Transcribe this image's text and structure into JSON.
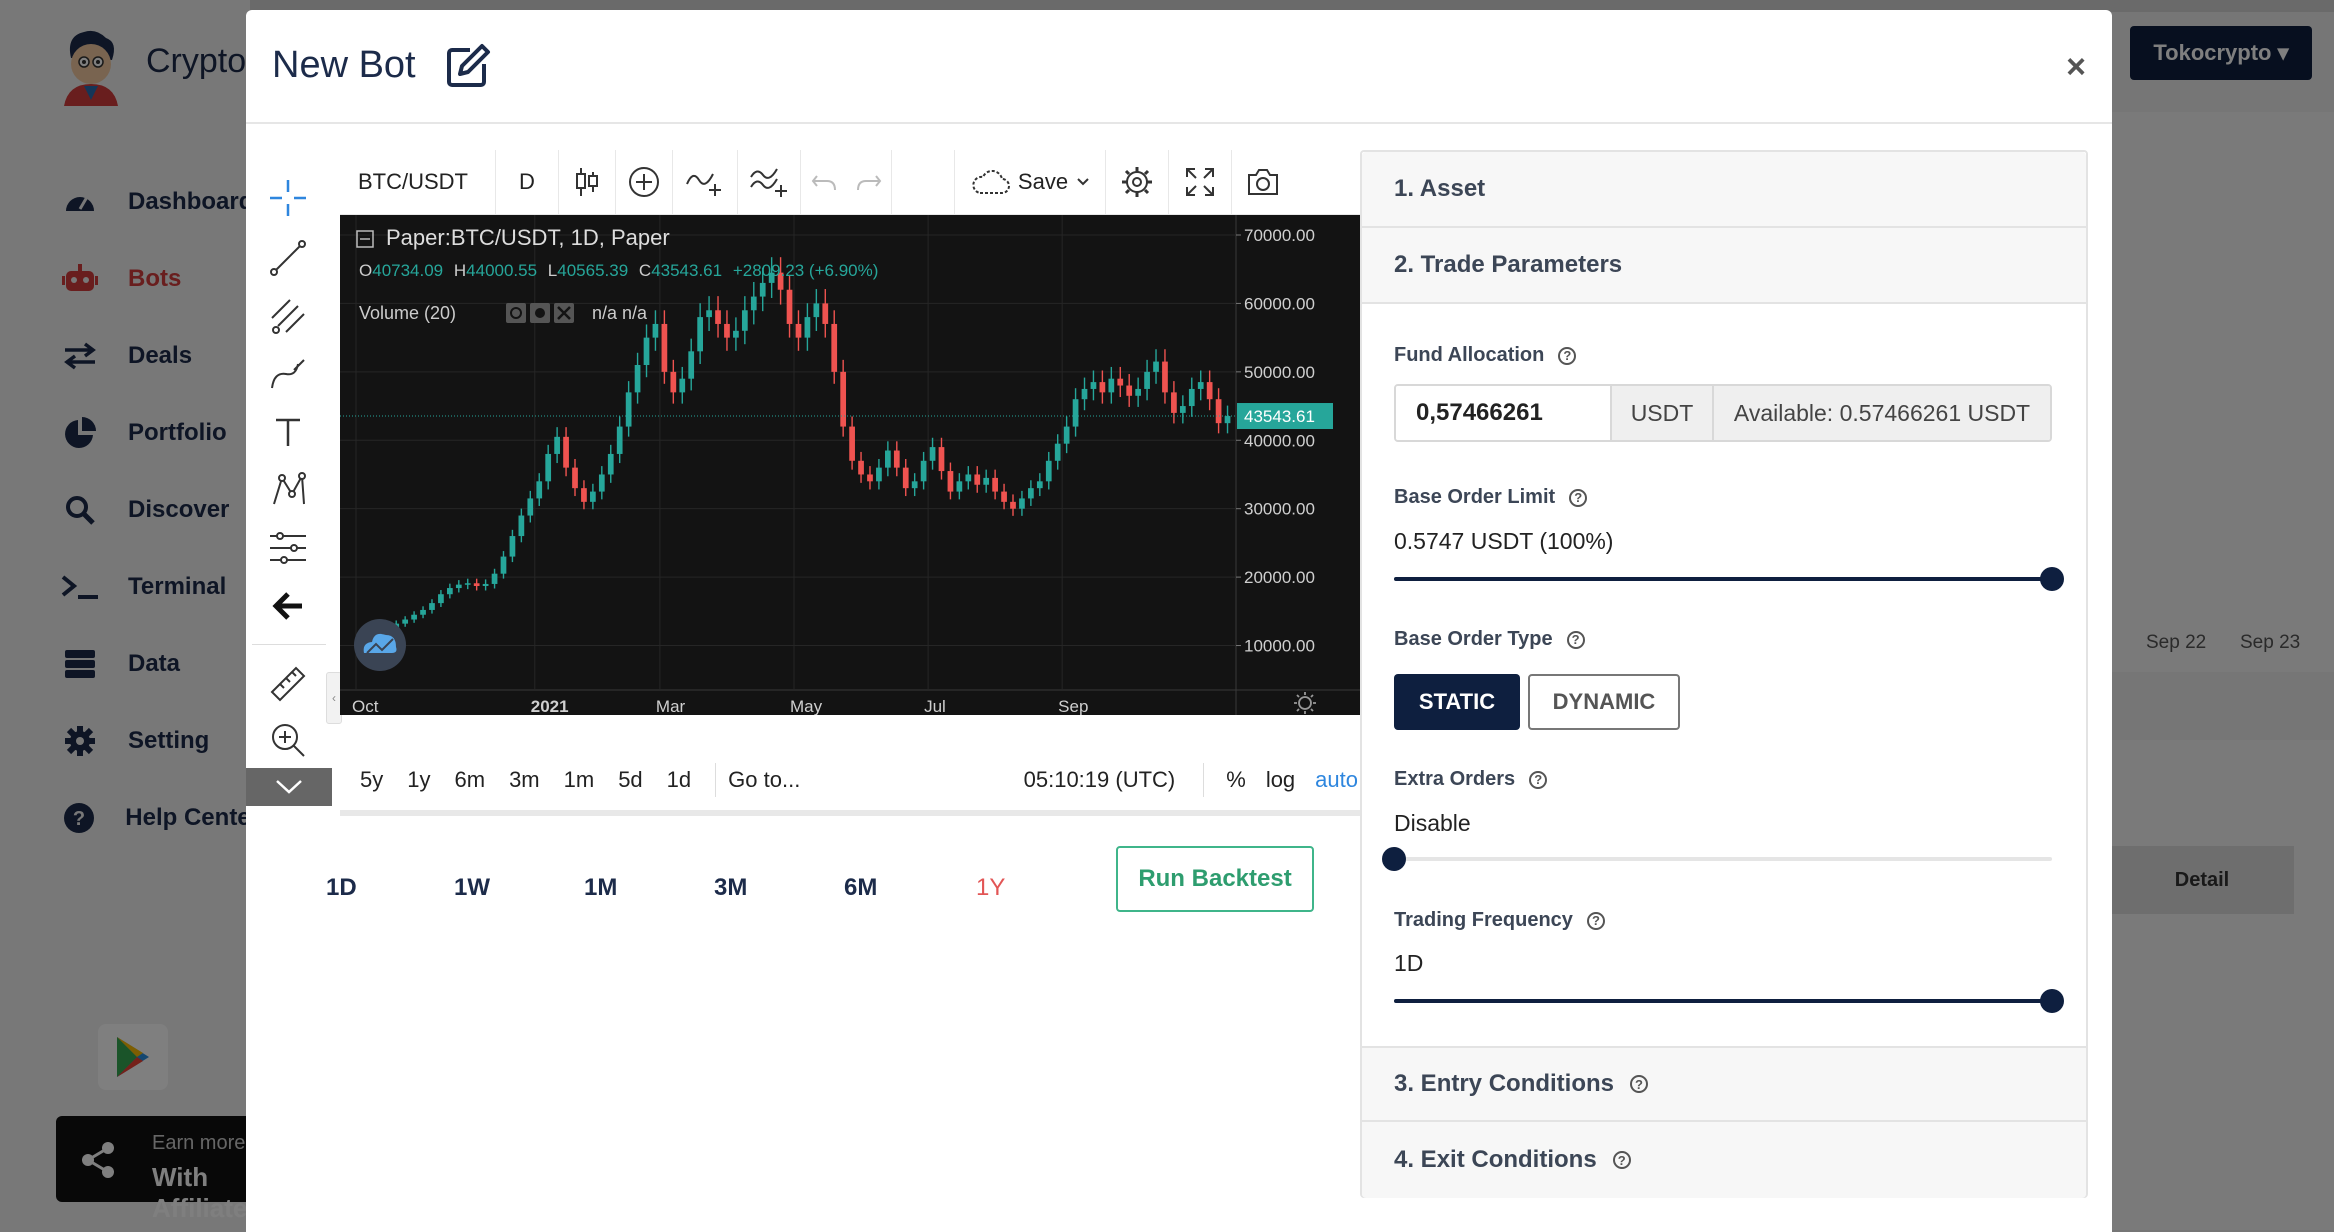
{
  "background": {
    "brand": "Crypto",
    "nav": [
      {
        "label": "Dashboard",
        "icon": "gauge-icon"
      },
      {
        "label": "Bots",
        "icon": "robot-icon"
      },
      {
        "label": "Deals",
        "icon": "arrows-icon"
      },
      {
        "label": "Portfolio",
        "icon": "pie-icon"
      },
      {
        "label": "Discover",
        "icon": "search-icon"
      },
      {
        "label": "Terminal",
        "icon": "terminal-icon"
      },
      {
        "label": "Data",
        "icon": "database-icon"
      },
      {
        "label": "Setting",
        "icon": "gear-icon"
      },
      {
        "label": "Help Center",
        "icon": "help-icon"
      }
    ],
    "earn_line1": "Earn more",
    "earn_line2": "With Affiliate",
    "exchange": "Tokocrypto",
    "dates": [
      "Sep 22",
      "Sep 23"
    ],
    "detail": "Detail"
  },
  "modal": {
    "title": "New Bot",
    "close": "×"
  },
  "chart_widget": {
    "symbol": "BTC/USDT",
    "interval": "D",
    "save_label": "Save",
    "legend_title": "Paper:BTC/USDT, 1D, Paper",
    "ohlc": {
      "o": "40734.09",
      "h": "44000.55",
      "l": "40565.39",
      "c": "43543.61",
      "change": "+2809.23 (+6.90%)"
    },
    "volume_label": "Volume (20)",
    "volume_values": "n/a n/a",
    "ranges": [
      "5y",
      "1y",
      "6m",
      "3m",
      "1m",
      "5d",
      "1d"
    ],
    "goto": "Go to...",
    "time": "05:10:19 (UTC)",
    "percent": "%",
    "log": "log",
    "auto": "auto"
  },
  "chart_data": {
    "type": "candlestick",
    "title": "Paper:BTC/USDT, 1D, Paper",
    "xlabel": "",
    "ylabel": "",
    "x_ticks": [
      "Oct",
      "2021",
      "Mar",
      "May",
      "Jul",
      "Sep"
    ],
    "y_ticks": [
      "70000.00",
      "60000.00",
      "50000.00",
      "40000.00",
      "30000.00",
      "20000.00",
      "10000.00"
    ],
    "ylim": [
      3500,
      70000
    ],
    "last_price": "43543.61",
    "series": [
      {
        "values": [
          10600,
          11200,
          11800,
          12500,
          13200,
          13800,
          14500,
          15200,
          16200,
          17500,
          18400,
          18900,
          19100,
          18700,
          19000,
          20500,
          23000,
          26000,
          29000,
          31500,
          34000,
          38000,
          40500,
          36000,
          33000,
          31000,
          32500,
          35000,
          38000,
          42000,
          47000,
          51000,
          55000,
          57000,
          50000,
          47000,
          49000,
          53000,
          58000,
          59000,
          57000,
          55000,
          56000,
          59000,
          61000,
          63000,
          64500,
          62000,
          57000,
          55000,
          58000,
          60000,
          57000,
          50000,
          42000,
          37000,
          35000,
          34000,
          36000,
          38500,
          36000,
          33000,
          34000,
          37000,
          39000,
          35500,
          32500,
          34000,
          35000,
          33500,
          34500,
          32500,
          31000,
          30000,
          31500,
          33000,
          34000,
          37000,
          39500,
          42000,
          46000,
          47500,
          48500,
          47000,
          49000,
          48000,
          46500,
          47500,
          50000,
          51500,
          47000,
          44000,
          45000,
          47500,
          48500,
          46000,
          42500,
          43543
        ]
      }
    ]
  },
  "periods": [
    "1D",
    "1W",
    "1M",
    "3M",
    "6M",
    "1Y"
  ],
  "active_period": "1Y",
  "run_backtest": "Run Backtest",
  "accordion": {
    "asset": "1. Asset",
    "trade_parameters": "2. Trade Parameters",
    "entry_conditions": "3. Entry Conditions",
    "exit_conditions": "4. Exit Conditions"
  },
  "fund_allocation": {
    "label": "Fund Allocation",
    "value": "0,57466261",
    "unit": "USDT",
    "available": "Available: 0.57466261 USDT"
  },
  "base_order_limit": {
    "label": "Base Order Limit",
    "value": "0.5747 USDT (100%)",
    "slider_fraction": 1.0
  },
  "base_order_type": {
    "label": "Base Order Type",
    "options": [
      "STATIC",
      "DYNAMIC"
    ],
    "selected": "STATIC"
  },
  "extra_orders": {
    "label": "Extra Orders",
    "value": "Disable",
    "slider_fraction": 0.0
  },
  "trading_frequency": {
    "label": "Trading Frequency",
    "value": "1D",
    "slider_fraction": 1.0
  },
  "colors": {
    "navy": "#0e1f3f",
    "up": "#26a69a",
    "down": "#ef5350",
    "active_period": "#e25555",
    "run": "#2e9d6f"
  }
}
